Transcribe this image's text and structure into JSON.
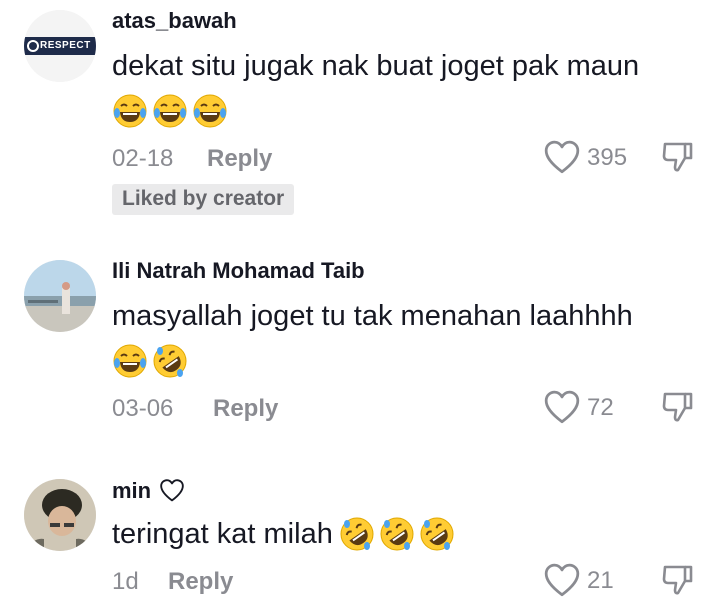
{
  "comments": [
    {
      "username": "atas_bawah",
      "avatar_text": "RESPECT",
      "text": "dekat situ jugak nak buat joget pak maun",
      "emojis": [
        "laughing-tears",
        "laughing-tears",
        "laughing-tears"
      ],
      "date": "02-18",
      "reply_label": "Reply",
      "likes": "395",
      "badge": "Liked by creator"
    },
    {
      "username": "Ili Natrah Mohamad Taib",
      "text": "masyallah joget tu tak menahan laahhhh",
      "emojis": [
        "laughing-tears",
        "rolling-laughing"
      ],
      "date": "03-06",
      "reply_label": "Reply",
      "likes": "72"
    },
    {
      "username": "min",
      "username_icon": "heart-outline",
      "text": "teringat kat milah",
      "emojis": [
        "rolling-laughing",
        "rolling-laughing",
        "rolling-laughing"
      ],
      "date": "1d",
      "reply_label": "Reply",
      "likes": "21"
    }
  ]
}
